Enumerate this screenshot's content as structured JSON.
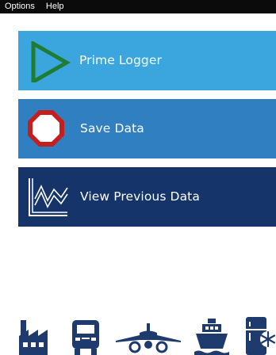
{
  "menu": {
    "options_label": "Options",
    "help_label": "Help"
  },
  "tiles": [
    {
      "label": "Prime Logger",
      "icon": "play-triangle-icon",
      "color": "#3aa6dd"
    },
    {
      "label": "Save Data",
      "icon": "stop-octagon-icon",
      "color": "#2f7fc1"
    },
    {
      "label": "View Previous Data",
      "icon": "line-chart-icon",
      "color": "#15346a"
    }
  ],
  "bottom_icons": [
    "factory-icon",
    "truck-icon",
    "airplane-icon",
    "ship-icon",
    "refrigerator-icon"
  ],
  "colors": {
    "icon_navy": "#1f3b6e",
    "play_green": "#1e7d32",
    "stop_red": "#c41e1e"
  }
}
